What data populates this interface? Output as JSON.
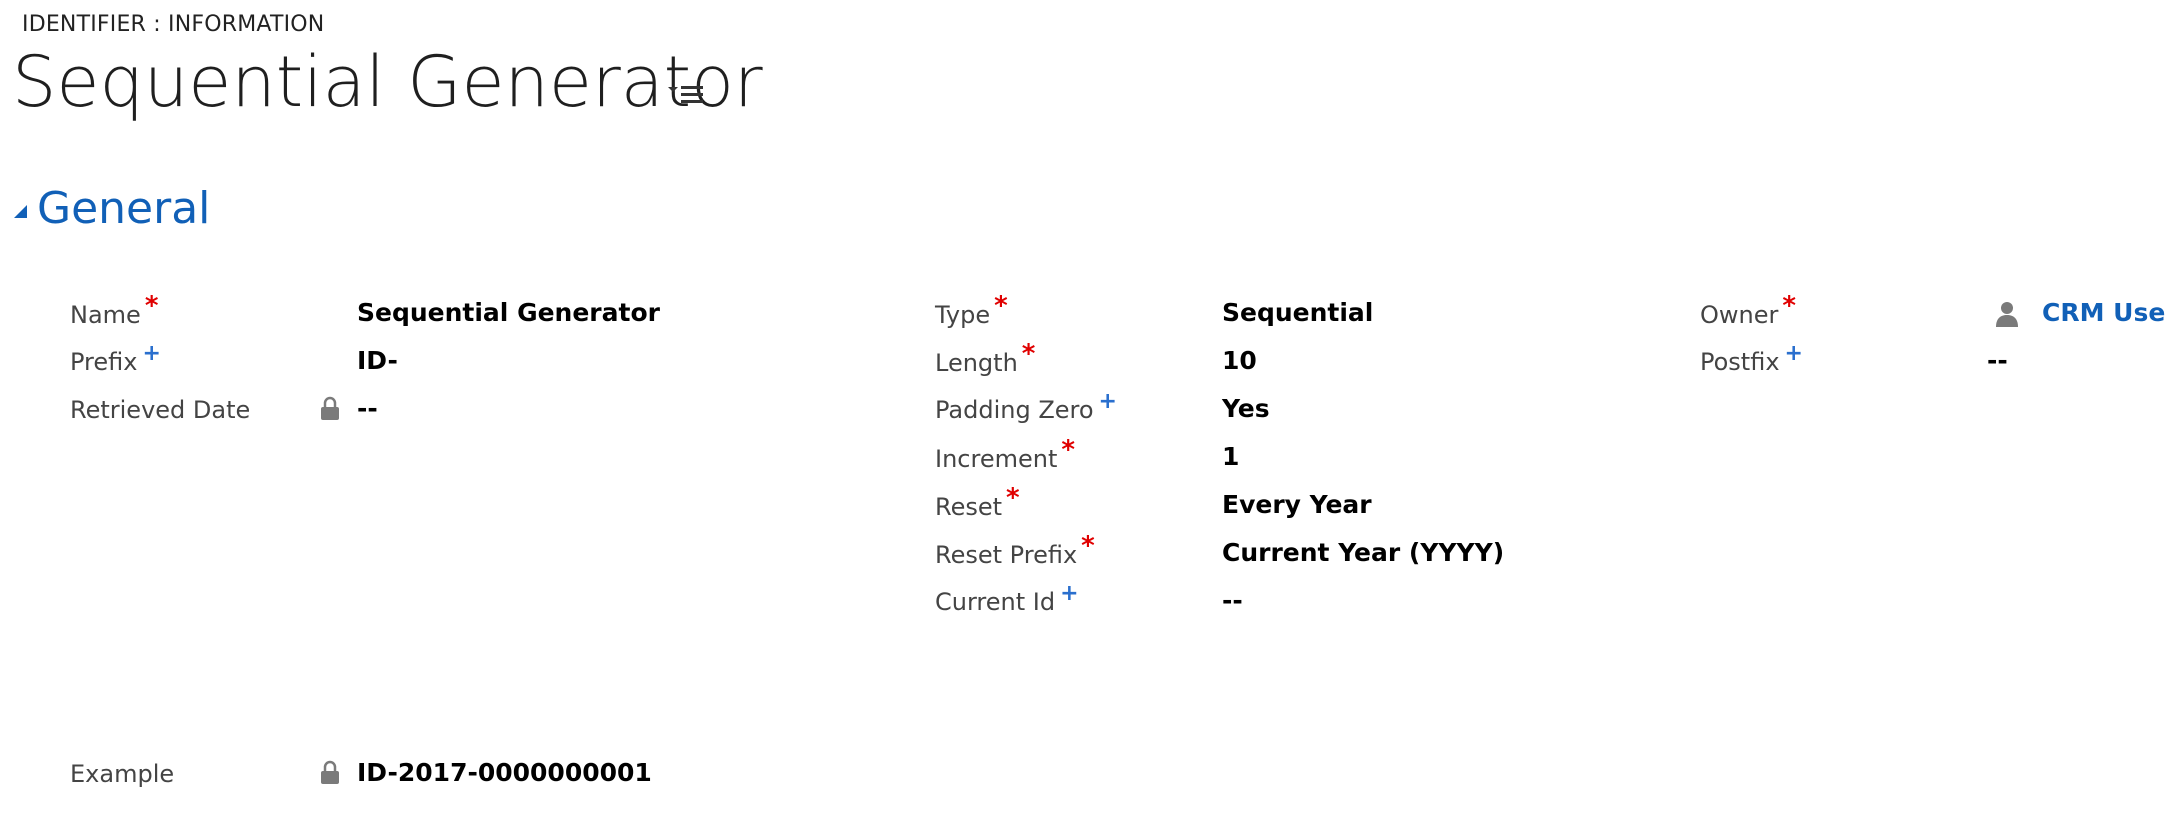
{
  "header": {
    "entity_label": "IDENTIFIER : INFORMATION",
    "record_title": "Sequential Generator"
  },
  "section": {
    "title": "General"
  },
  "col1": {
    "name": {
      "label": "Name",
      "value": "Sequential Generator",
      "marker": "*"
    },
    "prefix": {
      "label": "Prefix",
      "value": "ID-",
      "marker": "+"
    },
    "retrieved_date": {
      "label": "Retrieved Date",
      "value": "--"
    },
    "example": {
      "label": "Example",
      "value": "ID-2017-0000000001"
    }
  },
  "col2": {
    "type": {
      "label": "Type",
      "value": "Sequential",
      "marker": "*"
    },
    "length": {
      "label": "Length",
      "value": "10",
      "marker": "*"
    },
    "padding_zero": {
      "label": "Padding Zero",
      "value": "Yes",
      "marker": "+"
    },
    "increment": {
      "label": "Increment",
      "value": "1",
      "marker": "*"
    },
    "reset": {
      "label": "Reset",
      "value": "Every Year",
      "marker": "*"
    },
    "reset_prefix": {
      "label": "Reset Prefix",
      "value": "Current Year (YYYY)",
      "marker": "*"
    },
    "current_id": {
      "label": "Current Id",
      "value": "--",
      "marker": "+"
    }
  },
  "col3": {
    "owner": {
      "label": "Owner",
      "value": "CRM User",
      "marker": "*"
    },
    "postfix": {
      "label": "Postfix",
      "value": "--",
      "marker": "+"
    }
  },
  "colors": {
    "accent": "#1160b7",
    "required": "#e00000",
    "recommended": "#2a6fce"
  },
  "icons": {
    "form_selector": "list-menu-icon",
    "section_toggle": "collapse-triangle-icon",
    "lock": "lock-icon",
    "owner": "user-icon"
  }
}
